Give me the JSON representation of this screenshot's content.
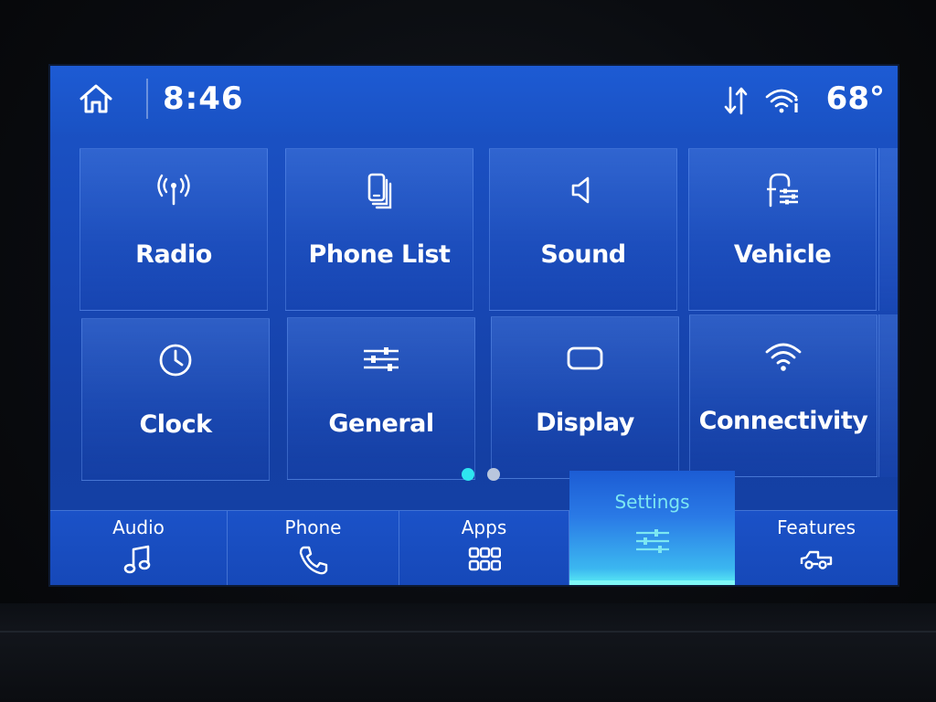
{
  "status": {
    "time": "8:46",
    "temperature": "68°"
  },
  "tiles": [
    {
      "label": "Radio",
      "icon": "radio-antenna-icon"
    },
    {
      "label": "Phone List",
      "icon": "phone-list-icon"
    },
    {
      "label": "Sound",
      "icon": "speaker-icon"
    },
    {
      "label": "Vehicle",
      "icon": "vehicle-settings-icon"
    },
    {
      "label": "Clock",
      "icon": "clock-icon"
    },
    {
      "label": "General",
      "icon": "sliders-icon"
    },
    {
      "label": "Display",
      "icon": "display-icon"
    },
    {
      "label": "Connectivity",
      "icon": "wifi-icon"
    }
  ],
  "pagination": {
    "current": 1,
    "total": 2
  },
  "nav": [
    {
      "label": "Audio",
      "icon": "music-note-icon",
      "active": false
    },
    {
      "label": "Phone",
      "icon": "phone-icon",
      "active": false
    },
    {
      "label": "Apps",
      "icon": "apps-grid-icon",
      "active": false
    },
    {
      "label": "Settings",
      "icon": "settings-sliders-icon",
      "active": true
    },
    {
      "label": "Features",
      "icon": "truck-icon",
      "active": false
    }
  ],
  "colors": {
    "screen_blue": "#1848b6",
    "accent_cyan": "#2ee5f0",
    "text": "#ffffff"
  }
}
